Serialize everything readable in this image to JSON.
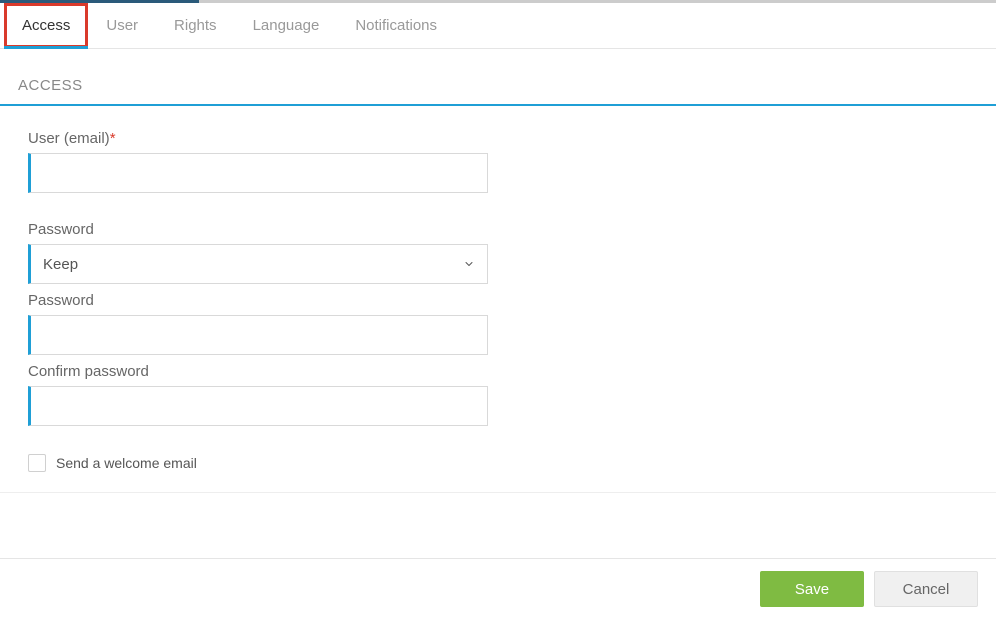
{
  "tabs": {
    "access": {
      "label": "Access",
      "active": true
    },
    "user": {
      "label": "User",
      "active": false
    },
    "rights": {
      "label": "Rights",
      "active": false
    },
    "language": {
      "label": "Language",
      "active": false
    },
    "notifications": {
      "label": "Notifications",
      "active": false
    }
  },
  "section": {
    "title": "ACCESS"
  },
  "form": {
    "user_email": {
      "label": "User (email)",
      "required_mark": "*",
      "value": ""
    },
    "password_mode": {
      "label": "Password",
      "selected": "Keep"
    },
    "password": {
      "label": "Password",
      "value": ""
    },
    "confirm_password": {
      "label": "Confirm password",
      "value": ""
    },
    "welcome_email": {
      "label": "Send a welcome email",
      "checked": false
    }
  },
  "footer": {
    "save": "Save",
    "cancel": "Cancel"
  }
}
